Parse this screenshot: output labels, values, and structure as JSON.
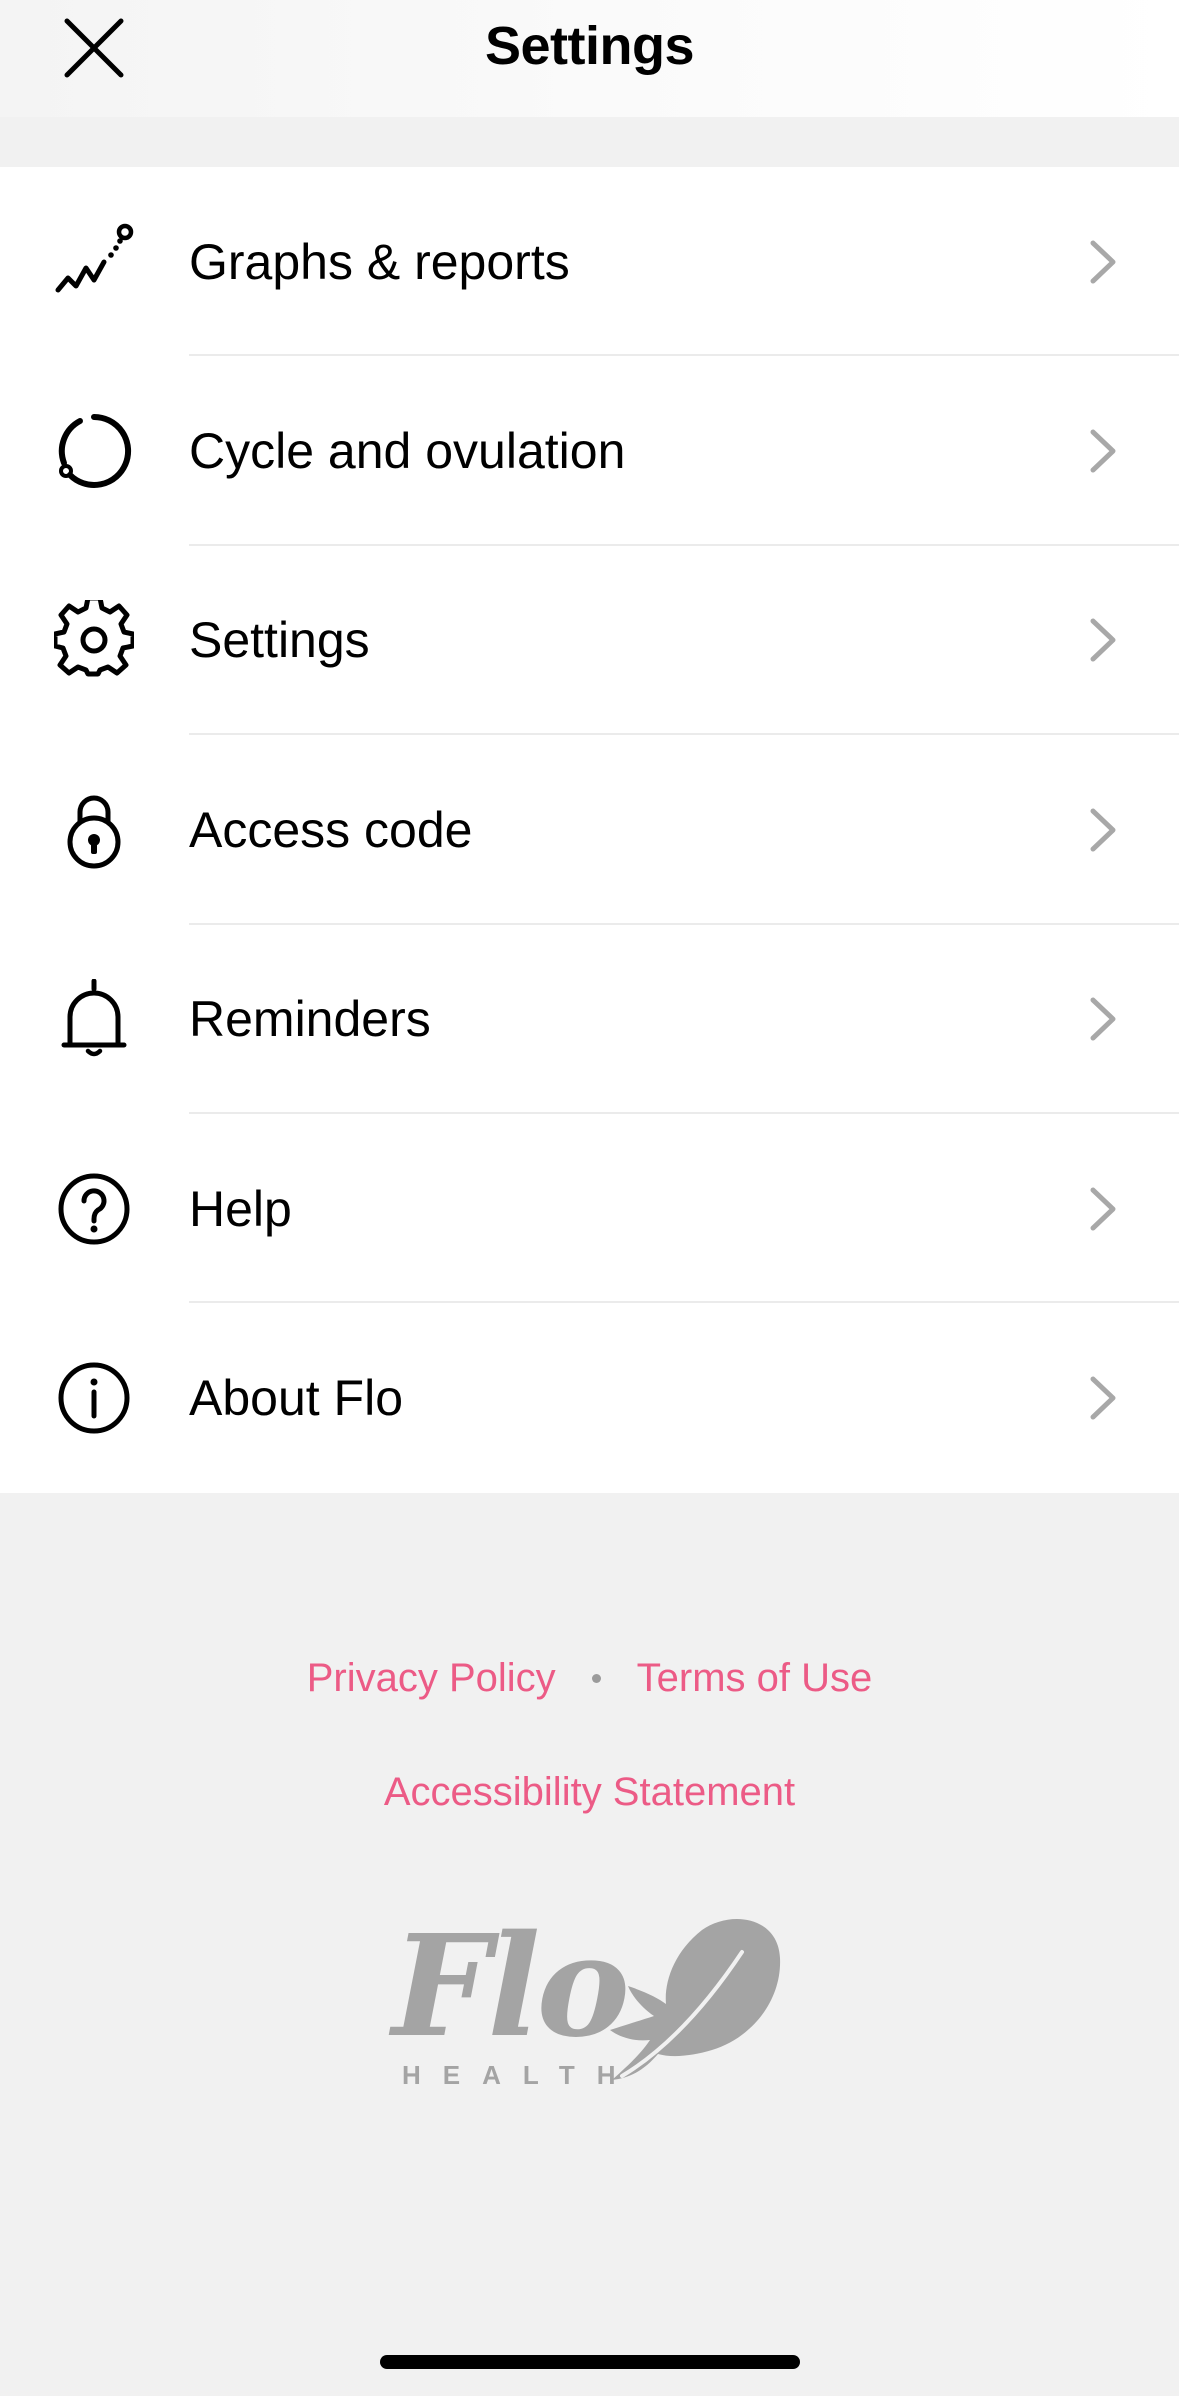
{
  "header": {
    "title": "Settings",
    "close_icon": "close-icon"
  },
  "menu": {
    "items": [
      {
        "label": "Graphs & reports",
        "icon": "graph-icon"
      },
      {
        "label": "Cycle and ovulation",
        "icon": "cycle-icon"
      },
      {
        "label": "Settings",
        "icon": "gear-icon"
      },
      {
        "label": "Access code",
        "icon": "lock-icon"
      },
      {
        "label": "Reminders",
        "icon": "bell-icon"
      },
      {
        "label": "Help",
        "icon": "question-icon"
      },
      {
        "label": "About Flo",
        "icon": "info-icon"
      }
    ],
    "chevron_icon": "chevron-right-icon"
  },
  "footer": {
    "privacy_policy": "Privacy Policy",
    "terms_of_use": "Terms of Use",
    "accessibility_statement": "Accessibility Statement",
    "link_color": "#ec5b86"
  },
  "logo": {
    "wordmark": "Flo",
    "subtitle": "HEALTH",
    "color": "#a4a4a4"
  },
  "colors": {
    "background": "#f1f1f1",
    "surface": "#ffffff",
    "divider": "#ebebeb",
    "chevron": "#a8a8a8"
  }
}
